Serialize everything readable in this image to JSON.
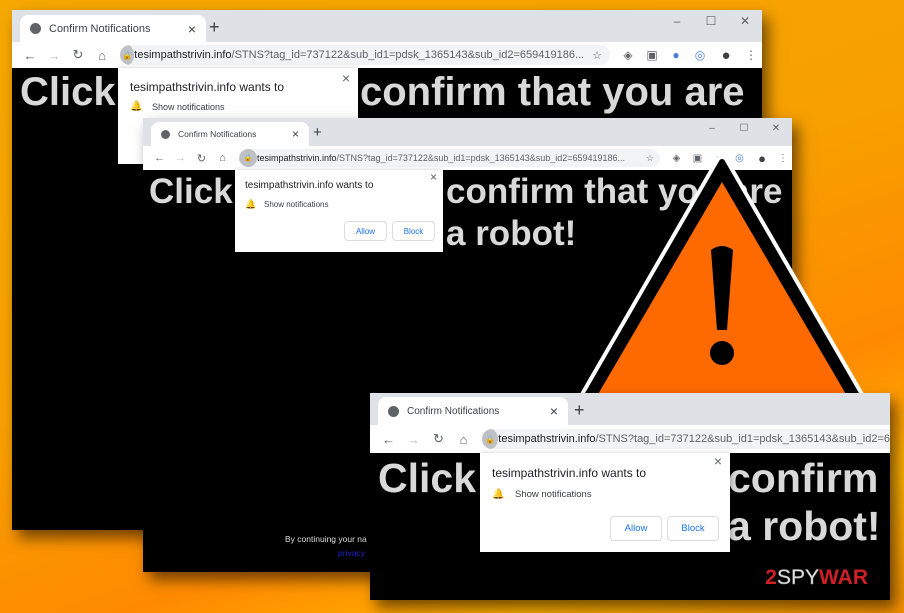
{
  "colors": {
    "background": "#f6a800",
    "warning_fill": "#ff6a00",
    "link": "#1a22c8",
    "button_text": "#1a73e8"
  },
  "window1": {
    "tab_title": "Confirm Notifications",
    "tab_close": "×",
    "new_tab": "+",
    "window_controls": [
      "–",
      "☐",
      "✕"
    ],
    "url_host": "tesimpathstrivin.info",
    "url_path": "/STNS?tag_id=737122&sub_id1=pdsk_1365143&sub_id2=659419186...",
    "headline_left": "Click",
    "headline_right": "confirm that you are",
    "popup": {
      "title": "tesimpathstrivin.info wants to",
      "permission": "Show notifications",
      "close": "×"
    }
  },
  "window2": {
    "tab_title": "Confirm Notifications",
    "tab_close": "×",
    "new_tab": "+",
    "window_controls": [
      "–",
      "☐",
      "✕"
    ],
    "url_host": "tesimpathstrivin.info",
    "url_path": "/STNS?tag_id=737122&sub_id1=pdsk_1365143&sub_id2=659419186...",
    "headline_left": "Click",
    "headline_right": "confirm that you are",
    "headline_line2": "a robot!",
    "footer_text": "By continuing your na",
    "footer_link": "privacy",
    "popup": {
      "title": "tesimpathstrivin.info wants to",
      "permission": "Show notifications",
      "close": "×",
      "allow": "Allow",
      "block": "Block"
    }
  },
  "window3": {
    "tab_title": "Confirm Notifications",
    "tab_close": "×",
    "new_tab": "+",
    "url_host": "tesimpathstrivin.info",
    "url_path": "/STNS?tag_id=737122&sub_id1=pdsk_1365143&sub_id2=6",
    "headline_left": "Click",
    "headline_right": "confirm",
    "headline_line2": "a robot!",
    "popup": {
      "title": "tesimpathstrivin.info wants to",
      "permission": "Show notifications",
      "close": "×",
      "allow": "Allow",
      "block": "Block"
    }
  },
  "warning": {
    "symbol": "!"
  },
  "watermark": {
    "part1": "2",
    "part2": "SPY",
    "part3": "WAR"
  }
}
